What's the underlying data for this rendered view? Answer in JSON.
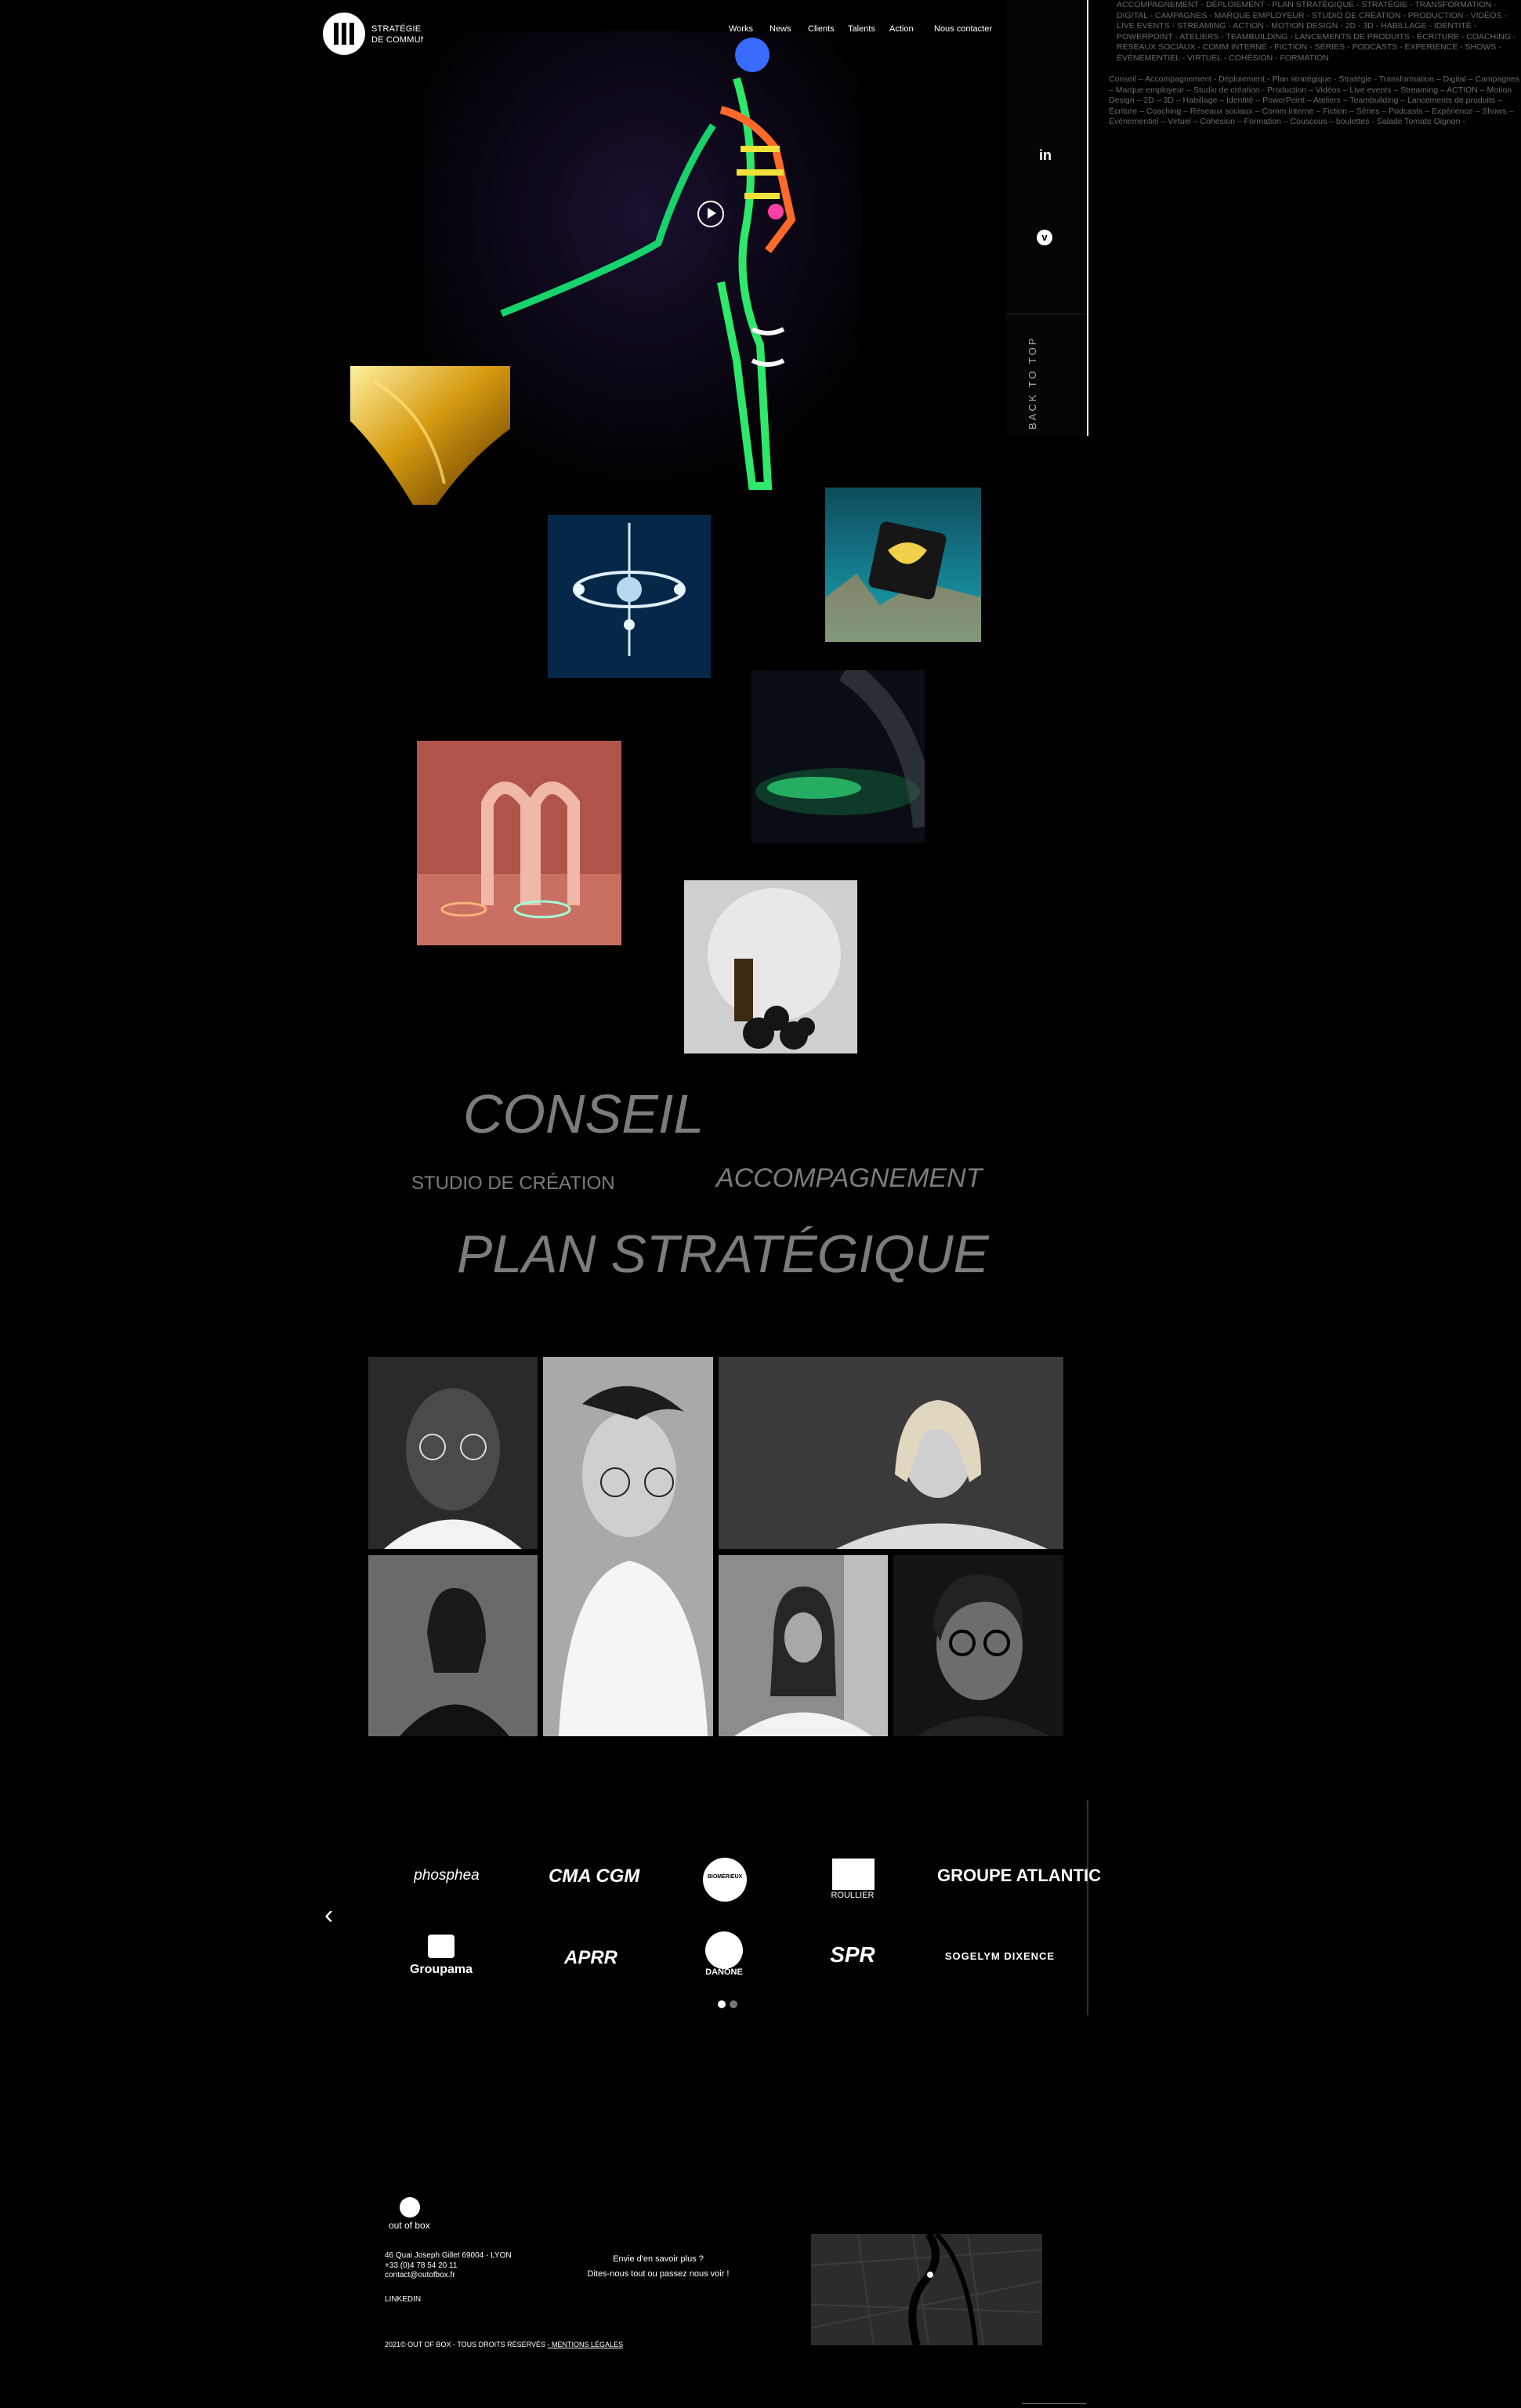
{
  "header": {
    "brand_line1": "STRATÉGIE",
    "brand_line2": "DE COMMUNICATION",
    "nav": [
      "Works",
      "News",
      "Clients",
      "Talents",
      "Action",
      "Nous contacter"
    ]
  },
  "side": {
    "social": [
      "linkedin-icon",
      "vimeo-icon"
    ],
    "back_to_top": "BACK TO TOP",
    "keywords_1": "ACCOMPAGNEMENT - DÉPLOIEMENT - PLAN STRATÉGIQUE - STRATÉGIE - TRANSFORMATION - DIGITAL - CAMPAGNES - MARQUE EMPLOYEUR - STUDIO DE CRÉATION - PRODUCTION - VIDÉOS - LIVE EVENTS - STREAMING - ACTION - MOTION DESIGN - 2D - 3D - HABILLAGE - IDENTITÉ - POWERPOINT - ATELIERS - TEAMBUILDING - LANCEMENTS DE PRODUITS - ÉCRITURE - COACHING - RÉSEAUX SOCIAUX - COMM INTERNE - FICTION - SÉRIES - PODCASTS - EXPERIENCE - SHOWS - ÉVÉNEMENTIEL - VIRTUEL - COHÉSION - FORMATION",
    "keywords_2": "Conseil – Accompagnement - Déploiement - Plan stratégique - Stratégie - Transformation – Digital – Campagnes – Marque employeur – Studio de création - Production – Vidéos – Live events – Streaming – ACTION – Motion Design – 2D – 3D – Habillage – Identité – PowerPoint – Ateliers – Teambuilding – Lancements de produits – Écriture – Coaching – Réseaux sociaux – Comm interne – Fiction – Séries – Podcasts – Expérience – Shows – Événementiel – Virtuel – Cohésion – Formation – Couscous – boulettes - Salade Tomate Oignon -"
  },
  "words": {
    "conseil": "CONSEIL",
    "studio": "STUDIO DE CRÉATION",
    "accompagnement": "ACCOMPAGNEMENT",
    "plan": "PLAN STRATÉGIQUE"
  },
  "clients": {
    "row1": [
      "phosphea",
      "CMA CGM",
      "BIOMÉRIEUX",
      "ROULLIER",
      "GROUPE ATLANTIC"
    ],
    "row2": [
      "Groupama",
      "APRR",
      "DANONE",
      "SPR",
      "SOGELYM DIXENCE"
    ],
    "prev_icon": "chevron-left-icon"
  },
  "footer": {
    "logo_text": "out of box",
    "address": "46 Quai Joseph Gillet  69004 - LYON",
    "phone": "+33 (0)4 78 54 20 11",
    "email": "contact@outofbox.fr",
    "linkedin": "LINKEDIN",
    "cta_line1": "Envie d'en savoir plus  ?",
    "cta_line2": "Dites-nous  tout ou passez nous voir  !",
    "copyright": "2021© OUT OF BOX - TOUS DROITS RÉSERVÉS",
    "mentions": "- MENTIONS LÉGALES"
  },
  "colors": {
    "background": "#000000",
    "text": "#ffffff",
    "muted_text": "#7c7c7c",
    "keyword_text": "#6a6a6a"
  }
}
